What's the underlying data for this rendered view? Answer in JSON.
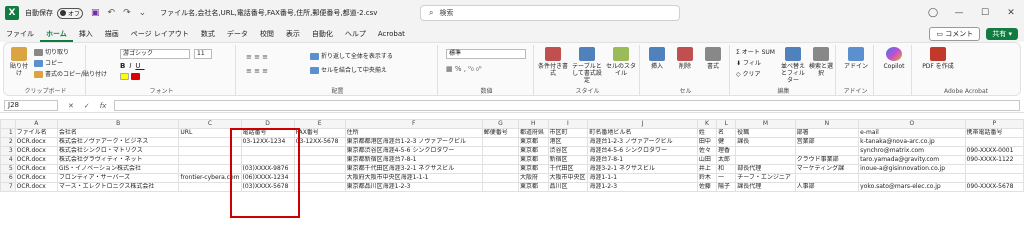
{
  "titlebar": {
    "autosave_label": "自動保存",
    "autosave_state": "オフ",
    "filename": "ファイル名,会社名,URL,電話番号,FAX番号,住所,郵便番号,都道-2.csv",
    "search_placeholder": "検索"
  },
  "menu": {
    "items": [
      "ファイル",
      "ホーム",
      "挿入",
      "描画",
      "ページ レイアウト",
      "数式",
      "データ",
      "校閲",
      "表示",
      "自動化",
      "ヘルプ",
      "Acrobat"
    ],
    "comment": "コメント",
    "share": "共有"
  },
  "ribbon": {
    "clipboard": {
      "paste": "貼り付け",
      "cut": "切り取り",
      "copy": "コピー",
      "format_painter": "書式のコピー/貼り付け",
      "label": "クリップボード"
    },
    "font": {
      "name": "游ゴシック",
      "size": "11",
      "label": "フォント"
    },
    "alignment": {
      "wrap": "折り返して全体を表示する",
      "merge": "セルを結合して中央揃え",
      "label": "配置"
    },
    "number": {
      "format": "標準",
      "label": "数値"
    },
    "styles": {
      "conditional": "条件付き書式",
      "table": "テーブルとして書式設定",
      "cell": "セルのスタイル",
      "label": "スタイル"
    },
    "cells": {
      "insert": "挿入",
      "delete": "削除",
      "format": "書式",
      "label": "セル"
    },
    "editing": {
      "autosum": "オート SUM",
      "fill": "フィル",
      "clear": "クリア",
      "sort": "並べ替えとフィルター",
      "find": "検索と選択",
      "label": "編集"
    },
    "addins": {
      "label": "アドイン",
      "btn": "アドイン"
    },
    "copilot": {
      "label": "Copilot"
    },
    "acrobat": {
      "pdf": "PDF を作成",
      "label": "Adobe Acrobat"
    }
  },
  "formula": {
    "cell": "J28",
    "fx": "fx",
    "content": ""
  },
  "grid": {
    "columns": [
      "A",
      "B",
      "C",
      "D",
      "E",
      "F",
      "G",
      "H",
      "I",
      "J",
      "K",
      "L",
      "M",
      "N",
      "O",
      "P"
    ],
    "rows": [
      [
        "ファイル名",
        "会社名",
        "URL",
        "電話番号",
        "FAX番号",
        "住所",
        "郵便番号",
        "都道府県",
        "市区町",
        "町名番地ビル名",
        "姓",
        "名",
        "役職",
        "部署",
        "e-mail",
        "携帯電話番号"
      ],
      [
        "OCR.docx",
        "株式会社ノヴァアーク・ビジネス",
        "",
        "03-12XX-1234",
        "03-12XX-5678",
        "東京都都港区海涯台1-2-3 ノヴァアークビル",
        "",
        "東京都",
        "港区",
        "海涯台1-2-3 ノヴァアークビル",
        "田中",
        "健",
        "課長",
        "営業部",
        "k-tanaka@nova-arc.co.jp",
        ""
      ],
      [
        "OCR.docx",
        "株式会社シンクロ・マトリクス",
        "",
        "",
        "",
        "東京都渋谷区海涯4-5-6 シンクロタワー",
        "",
        "東京都",
        "渋谷区",
        "海涯台4-5-6 シンクロタワー",
        "佐々",
        "理香",
        "",
        "",
        "synchro@matrix.com",
        "090-XXXX-0001"
      ],
      [
        "OCR.docx",
        "株式会社グラヴィティ・ネット",
        "",
        "",
        "",
        "東京都新宿区海涯台7-8-1",
        "",
        "東京都",
        "新宿区",
        "海涯台7-8-1",
        "山田",
        "太郎",
        "",
        "クラウド事業部",
        "taro.yamada@gravity.com",
        "090-XXXX-1122"
      ],
      [
        "OCR.docx",
        "GIS・イノベーション株式会社",
        "",
        "(03)XXXX-9876",
        "",
        "東京都千代田区海涯3-2-1 ネクサスビル",
        "",
        "東京都",
        "千代田区",
        "海涯3-2-1 ネクサスビル",
        "井上",
        "和",
        "部長代理",
        "マーケティング課",
        "inoue-a@gisinnovation.co.jp",
        ""
      ],
      [
        "OCR.docx",
        "フロンティア・サーバーズ",
        "frontier-cybera.com",
        "(06)XXXX-1234",
        "",
        "大阪府大阪市中央区海涯1-1-1",
        "",
        "大阪府",
        "大阪市中央区",
        "海涯1-1-1",
        "鈴木",
        "一",
        "チーフ・エンジニア",
        "",
        "",
        ""
      ],
      [
        "OCR.docx",
        "マース・エレクトロニクス株式会社",
        "",
        "(03)XXXX-5678",
        "",
        "東京都品川区海涯1-2-3",
        "",
        "東京都",
        "品川区",
        "海涯1-2-3",
        "佐藤",
        "陽子",
        "課長代理",
        "人事部",
        "yoko.sato@mars-elec.co.jp",
        "090-XXXX-5678"
      ]
    ]
  }
}
